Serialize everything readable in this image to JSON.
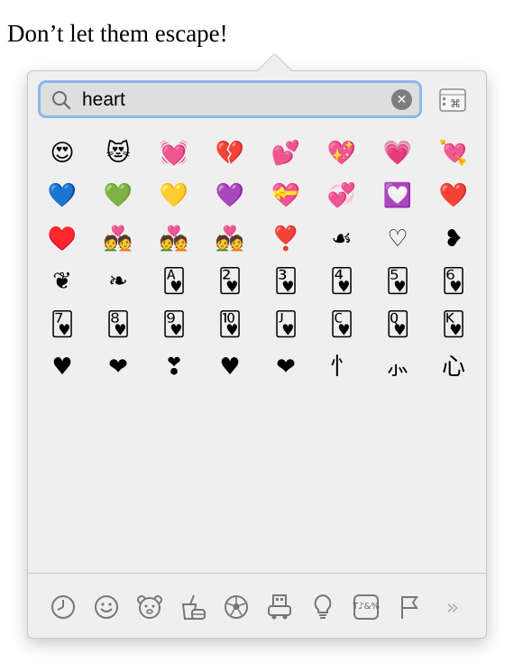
{
  "page": {
    "heading": "Don’t let them escape!"
  },
  "picker": {
    "search": {
      "value": "heart",
      "clear_glyph": "✕"
    },
    "keyboard_icon": "keyboard-viewer-icon",
    "emoji_grid": [
      {
        "glyph": "😍",
        "name": "smiling-face-heart-eyes"
      },
      {
        "glyph": "😻",
        "name": "cat-heart-eyes"
      },
      {
        "glyph": "💓",
        "name": "beating-heart"
      },
      {
        "glyph": "💔",
        "name": "broken-heart"
      },
      {
        "glyph": "💕",
        "name": "two-hearts"
      },
      {
        "glyph": "💖",
        "name": "sparkling-heart"
      },
      {
        "glyph": "💗",
        "name": "growing-heart"
      },
      {
        "glyph": "💘",
        "name": "heart-with-arrow"
      },
      {
        "glyph": "💙",
        "name": "blue-heart"
      },
      {
        "glyph": "💚",
        "name": "green-heart"
      },
      {
        "glyph": "💛",
        "name": "yellow-heart"
      },
      {
        "glyph": "💜",
        "name": "purple-heart"
      },
      {
        "glyph": "💝",
        "name": "heart-with-ribbon"
      },
      {
        "glyph": "💞",
        "name": "revolving-hearts"
      },
      {
        "glyph": "💟",
        "name": "heart-decoration"
      },
      {
        "glyph": "❤️",
        "name": "red-heart"
      },
      {
        "glyph": "♥️",
        "name": "heart-suit"
      },
      {
        "glyph": "💑",
        "name": "couple-with-heart"
      },
      {
        "glyph": "💑",
        "name": "couple-with-heart-woman-man"
      },
      {
        "glyph": "💑",
        "name": "couple-with-heart-women"
      },
      {
        "glyph": "❣️",
        "name": "heart-exclamation"
      },
      {
        "glyph": "☙",
        "name": "reversed-rotated-floral-heart"
      },
      {
        "glyph": "♡",
        "name": "white-heart-suit"
      },
      {
        "glyph": "❥",
        "name": "rotated-heavy-heart-bullet"
      },
      {
        "glyph": "❦",
        "name": "floral-heart"
      },
      {
        "glyph": "❧",
        "name": "rotated-floral-heart"
      },
      {
        "glyph": "🂱",
        "name": "ace-of-hearts"
      },
      {
        "glyph": "🂲",
        "name": "two-of-hearts"
      },
      {
        "glyph": "🂳",
        "name": "three-of-hearts"
      },
      {
        "glyph": "🂴",
        "name": "four-of-hearts"
      },
      {
        "glyph": "🂵",
        "name": "five-of-hearts"
      },
      {
        "glyph": "🂶",
        "name": "six-of-hearts"
      },
      {
        "glyph": "🂷",
        "name": "seven-of-hearts"
      },
      {
        "glyph": "🂸",
        "name": "eight-of-hearts"
      },
      {
        "glyph": "🂹",
        "name": "nine-of-hearts"
      },
      {
        "glyph": "🂺",
        "name": "ten-of-hearts"
      },
      {
        "glyph": "🂻",
        "name": "jack-of-hearts"
      },
      {
        "glyph": "🂼",
        "name": "knight-of-hearts"
      },
      {
        "glyph": "🂽",
        "name": "queen-of-hearts"
      },
      {
        "glyph": "🂾",
        "name": "king-of-hearts"
      },
      {
        "glyph": "♥",
        "name": "black-heart-suit"
      },
      {
        "glyph": "❤",
        "name": "heavy-black-heart"
      },
      {
        "glyph": "❣",
        "name": "heavy-heart-exclamation"
      },
      {
        "glyph": "♥",
        "name": "heart-suit-text"
      },
      {
        "glyph": "❤",
        "name": "heavy-heart-text"
      },
      {
        "glyph": "忄",
        "name": "heart-radical"
      },
      {
        "glyph": "⺗",
        "name": "heart-radical-bottom"
      },
      {
        "glyph": "心",
        "name": "heart-kanji"
      }
    ],
    "footer": [
      {
        "name": "recent-clock-icon"
      },
      {
        "name": "smileys-icon"
      },
      {
        "name": "animals-icon"
      },
      {
        "name": "food-icon"
      },
      {
        "name": "activity-soccer-icon"
      },
      {
        "name": "travel-icon"
      },
      {
        "name": "objects-lightbulb-icon"
      },
      {
        "name": "symbols-icon"
      },
      {
        "name": "flags-icon"
      },
      {
        "name": "more-chevron-icon"
      }
    ],
    "footer_labels": {
      "symbols_text": "T♪&%",
      "chevron": "»"
    }
  }
}
